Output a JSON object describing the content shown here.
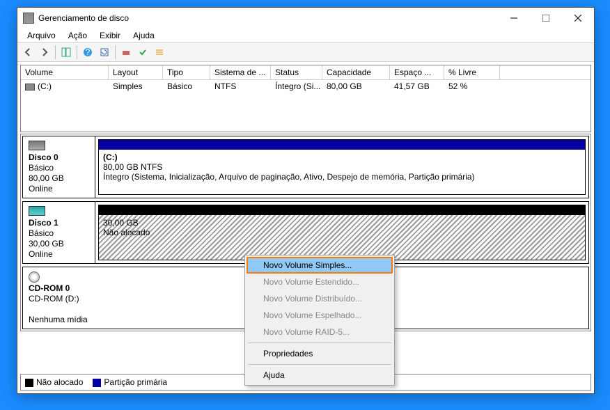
{
  "window": {
    "title": "Gerenciamento de disco"
  },
  "menu": {
    "file": "Arquivo",
    "action": "Ação",
    "view": "Exibir",
    "help": "Ajuda"
  },
  "columns": {
    "volume": "Volume",
    "layout": "Layout",
    "type": "Tipo",
    "fs": "Sistema de ...",
    "status": "Status",
    "capacity": "Capacidade",
    "free": "Espaço ...",
    "pct": "% Livre"
  },
  "row0": {
    "volume": "(C:)",
    "layout": "Simples",
    "type": "Básico",
    "fs": "NTFS",
    "status": "Íntegro (Si...",
    "capacity": "80,00 GB",
    "free": "41,57 GB",
    "pct": "52 %"
  },
  "disk0": {
    "name": "Disco 0",
    "type": "Básico",
    "size": "80,00 GB",
    "state": "Online",
    "part": {
      "label": "(C:)",
      "info": "80,00 GB NTFS",
      "status": "Íntegro (Sistema, Inicialização, Arquivo de paginação, Ativo, Despejo de memória, Partição primária)"
    }
  },
  "disk1": {
    "name": "Disco 1",
    "type": "Básico",
    "size": "30,00 GB",
    "state": "Online",
    "part": {
      "info": "30,00 GB",
      "status": "Não alocado"
    }
  },
  "cdrom": {
    "name": "CD-ROM 0",
    "drive": "CD-ROM (D:)",
    "state": "Nenhuma mídia"
  },
  "legend": {
    "unalloc": "Não alocado",
    "primary": "Partição primária"
  },
  "ctx": {
    "simple": "Novo Volume Simples...",
    "spanned": "Novo Volume Estendido...",
    "striped": "Novo Volume Distribuído...",
    "mirrored": "Novo Volume Espelhado...",
    "raid5": "Novo Volume RAID-5...",
    "props": "Propriedades",
    "help": "Ajuda"
  }
}
